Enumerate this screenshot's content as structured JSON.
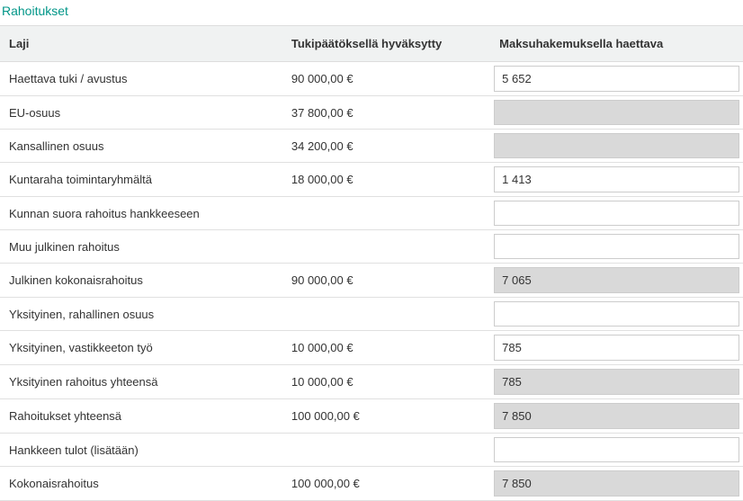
{
  "title": "Rahoitukset",
  "headers": {
    "laji": "Laji",
    "tuki": "Tukipäätöksellä hyväksytty",
    "maksu": "Maksuhakemuksella haettava"
  },
  "rows": [
    {
      "laji": "Haettava tuki / avustus",
      "tuki": "90 000,00 €",
      "maksu": "5 652",
      "editable": true
    },
    {
      "laji": "EU-osuus",
      "tuki": "37 800,00 €",
      "maksu": "",
      "editable": false
    },
    {
      "laji": "Kansallinen osuus",
      "tuki": "34 200,00 €",
      "maksu": "",
      "editable": false
    },
    {
      "laji": "Kuntaraha toimintaryhmältä",
      "tuki": "18 000,00 €",
      "maksu": "1 413",
      "editable": true
    },
    {
      "laji": "Kunnan suora rahoitus hankkeeseen",
      "tuki": "",
      "maksu": "",
      "editable": true
    },
    {
      "laji": "Muu julkinen rahoitus",
      "tuki": "",
      "maksu": "",
      "editable": true
    },
    {
      "laji": "Julkinen kokonaisrahoitus",
      "tuki": "90 000,00 €",
      "maksu": "7 065",
      "editable": false
    },
    {
      "laji": "Yksityinen, rahallinen osuus",
      "tuki": "",
      "maksu": "",
      "editable": true
    },
    {
      "laji": "Yksityinen, vastikkeeton työ",
      "tuki": "10 000,00 €",
      "maksu": "785",
      "editable": true
    },
    {
      "laji": "Yksityinen rahoitus yhteensä",
      "tuki": "10 000,00 €",
      "maksu": "785",
      "editable": false
    },
    {
      "laji": "Rahoitukset yhteensä",
      "tuki": "100 000,00 €",
      "maksu": "7 850",
      "editable": false
    },
    {
      "laji": "Hankkeen tulot (lisätään)",
      "tuki": "",
      "maksu": "",
      "editable": true
    },
    {
      "laji": "Kokonaisrahoitus",
      "tuki": "100 000,00 €",
      "maksu": "7 850",
      "editable": false
    }
  ]
}
